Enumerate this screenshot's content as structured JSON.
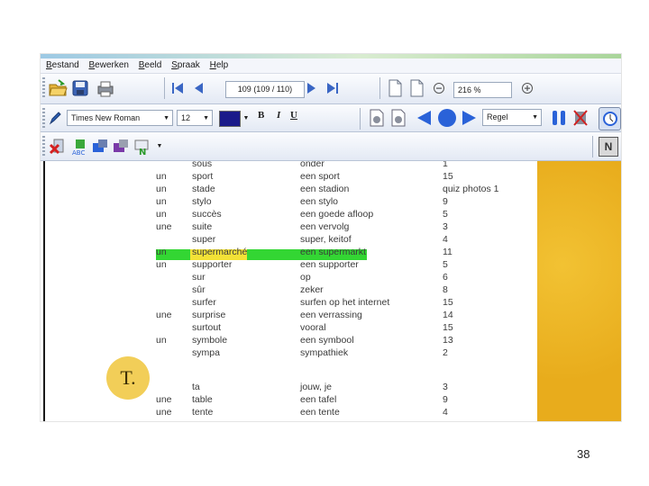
{
  "menu": [
    "Bestand",
    "Bewerken",
    "Beeld",
    "Spraak",
    "Help"
  ],
  "toolbar1": {
    "page_indicator": "109 (109 / 110)",
    "zoom": "216 %"
  },
  "toolbar2": {
    "font_name": "Times New Roman",
    "font_size": "12",
    "font_color": "#1a1a8a",
    "bold_label": "B",
    "italic_label": "I",
    "underline_label": "U",
    "read_mode": "Regel"
  },
  "toolbar3": {
    "n_badge": "N"
  },
  "colors": {
    "accent": "#2a62d8",
    "highlight_row": "#33d633",
    "highlight_word": "#f3e236",
    "side_panel": "#e8ac1c"
  },
  "section_letter": "T.",
  "rows": [
    {
      "art": "",
      "fr": "sous",
      "nl": "onder",
      "ref": "1"
    },
    {
      "art": "un",
      "fr": "sport",
      "nl": "een sport",
      "ref": "15"
    },
    {
      "art": "un",
      "fr": "stade",
      "nl": "een stadion",
      "ref": "quiz photos 1"
    },
    {
      "art": "un",
      "fr": "stylo",
      "nl": "een stylo",
      "ref": "9"
    },
    {
      "art": "un",
      "fr": "succès",
      "nl": "een goede afloop",
      "ref": "5"
    },
    {
      "art": "une",
      "fr": "suite",
      "nl": "een vervolg",
      "ref": "3"
    },
    {
      "art": "",
      "fr": "super",
      "nl": "super, keitof",
      "ref": "4"
    },
    {
      "art": "un",
      "fr": "supermarché",
      "nl": "een supermarkt",
      "ref": "11"
    },
    {
      "art": "un",
      "fr": "supporter",
      "nl": "een supporter",
      "ref": "5"
    },
    {
      "art": "",
      "fr": "sur",
      "nl": "op",
      "ref": "6"
    },
    {
      "art": "",
      "fr": "sûr",
      "nl": "zeker",
      "ref": "8"
    },
    {
      "art": "",
      "fr": "surfer",
      "nl": "surfen op het internet",
      "ref": "15"
    },
    {
      "art": "une",
      "fr": "surprise",
      "nl": "een verrassing",
      "ref": "14"
    },
    {
      "art": "",
      "fr": "surtout",
      "nl": "vooral",
      "ref": "15"
    },
    {
      "art": "un",
      "fr": "symbole",
      "nl": "een symbool",
      "ref": "13"
    },
    {
      "art": "",
      "fr": "sympa",
      "nl": "sympathiek",
      "ref": "2"
    },
    {
      "art": "",
      "fr": "ta",
      "nl": "jouw, je",
      "ref": "3"
    },
    {
      "art": "une",
      "fr": "table",
      "nl": "een tafel",
      "ref": "9"
    },
    {
      "art": "une",
      "fr": "tente",
      "nl": "een tente",
      "ref": "4"
    }
  ],
  "slide_number": "38"
}
